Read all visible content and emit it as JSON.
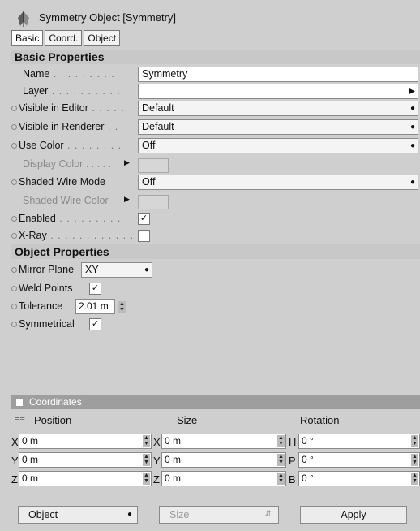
{
  "title": "Symmetry Object [Symmetry]",
  "tabs": [
    "Basic",
    "Coord.",
    "Object"
  ],
  "basic": {
    "header": "Basic Properties",
    "name_label": "Name",
    "name_value": "Symmetry",
    "layer_label": "Layer",
    "layer_value": "",
    "visible_editor_label": "Visible in Editor",
    "visible_editor_value": "Default",
    "visible_renderer_label": "Visible in Renderer",
    "visible_renderer_value": "Default",
    "use_color_label": "Use Color",
    "use_color_value": "Off",
    "display_color_label": "Display Color",
    "shaded_wire_mode_label": "Shaded Wire Mode",
    "shaded_wire_mode_value": "Off",
    "shaded_wire_color_label": "Shaded Wire Color",
    "enabled_label": "Enabled",
    "enabled_checked": true,
    "xray_label": "X-Ray",
    "xray_checked": false
  },
  "object": {
    "header": "Object Properties",
    "mirror_plane_label": "Mirror Plane",
    "mirror_plane_value": "XY",
    "weld_points_label": "Weld Points",
    "weld_points_checked": true,
    "tolerance_label": "Tolerance",
    "tolerance_value": "2.01 m",
    "symmetrical_label": "Symmetrical",
    "symmetrical_checked": true
  },
  "coordinates": {
    "header": "Coordinates",
    "col_position": "Position",
    "col_size": "Size",
    "col_rotation": "Rotation",
    "rows": [
      {
        "pos_axis": "X",
        "pos": "0 m",
        "size_axis": "X",
        "size": "0 m",
        "rot_axis": "H",
        "rot": "0 °"
      },
      {
        "pos_axis": "Y",
        "pos": "0 m",
        "size_axis": "Y",
        "size": "0 m",
        "rot_axis": "P",
        "rot": "0 °"
      },
      {
        "pos_axis": "Z",
        "pos": "0 m",
        "size_axis": "Z",
        "size": "0 m",
        "rot_axis": "B",
        "rot": "0 °"
      }
    ],
    "mode_value": "Object",
    "size_mode_value": "Size",
    "apply_label": "Apply"
  }
}
